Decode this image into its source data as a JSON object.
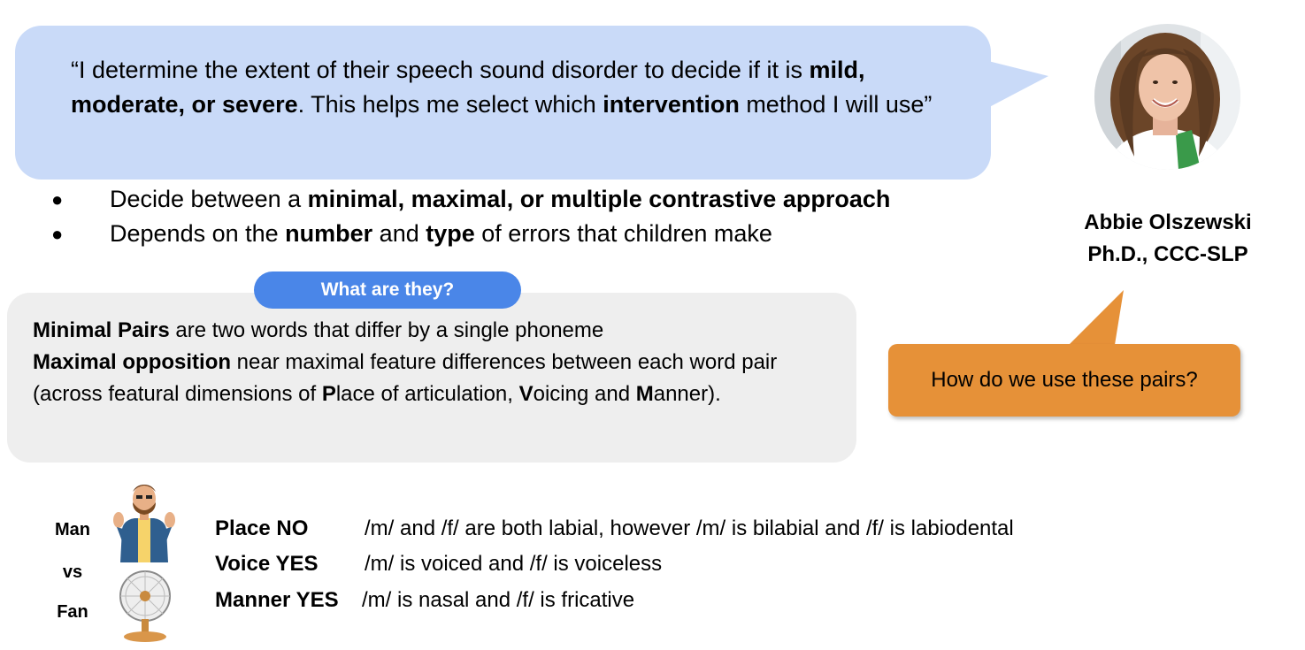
{
  "quote": {
    "segments": [
      {
        "text": "“I determine the extent of their speech sound disorder to decide if it is ",
        "bold": false
      },
      {
        "text": "mild, moderate, or severe",
        "bold": true
      },
      {
        "text": ".  This helps me select which ",
        "bold": false
      },
      {
        "text": "intervention",
        "bold": true
      },
      {
        "text": " method I will use”",
        "bold": false
      }
    ]
  },
  "bullets": [
    {
      "bullet": "●",
      "segments": [
        {
          "text": "Decide between a ",
          "bold": false
        },
        {
          "text": "minimal, maximal, or multiple contrastive approach",
          "bold": true
        }
      ]
    },
    {
      "bullet": "●",
      "segments": [
        {
          "text": "Depends on the ",
          "bold": false
        },
        {
          "text": "number",
          "bold": true
        },
        {
          "text": " and ",
          "bold": false
        },
        {
          "text": "type",
          "bold": true
        },
        {
          "text": " of errors that children make",
          "bold": false
        }
      ]
    }
  ],
  "person": {
    "name": "Abbie Olszewski",
    "credentials": "Ph.D., CCC-SLP"
  },
  "what_pill": {
    "label": "What are they?"
  },
  "definitions": {
    "line1": [
      {
        "text": "Minimal Pairs",
        "bold": true
      },
      {
        "text": " are two words that differ by a single phoneme",
        "bold": false
      }
    ],
    "line2": [
      {
        "text": "Maximal opposition",
        "bold": true
      },
      {
        "text": " near maximal feature differences between each word pair (across featural dimensions of ",
        "bold": false
      },
      {
        "text": "P",
        "bold": true
      },
      {
        "text": "lace of articulation, ",
        "bold": false
      },
      {
        "text": "V",
        "bold": true
      },
      {
        "text": "oicing and ",
        "bold": false
      },
      {
        "text": "M",
        "bold": true
      },
      {
        "text": "anner).",
        "bold": false
      }
    ]
  },
  "callout": {
    "text": "How do we use these pairs?"
  },
  "comparison": {
    "word1": "Man",
    "vs": "vs",
    "word2": "Fan",
    "features": [
      {
        "label": "Place NO",
        "desc": "/m/ and /f/ are both labial, however /m/ is bilabial and /f/ is labiodental"
      },
      {
        "label": "Voice YES",
        "desc": "/m/ is voiced and /f/ is voiceless"
      },
      {
        "label": "Manner YES",
        "desc": "/m/ is nasal and /f/ is fricative"
      }
    ]
  },
  "colors": {
    "quote_bubble": "#c9daf8",
    "pill": "#4a86e8",
    "grey_box": "#eeeeee",
    "callout": "#e69138"
  }
}
